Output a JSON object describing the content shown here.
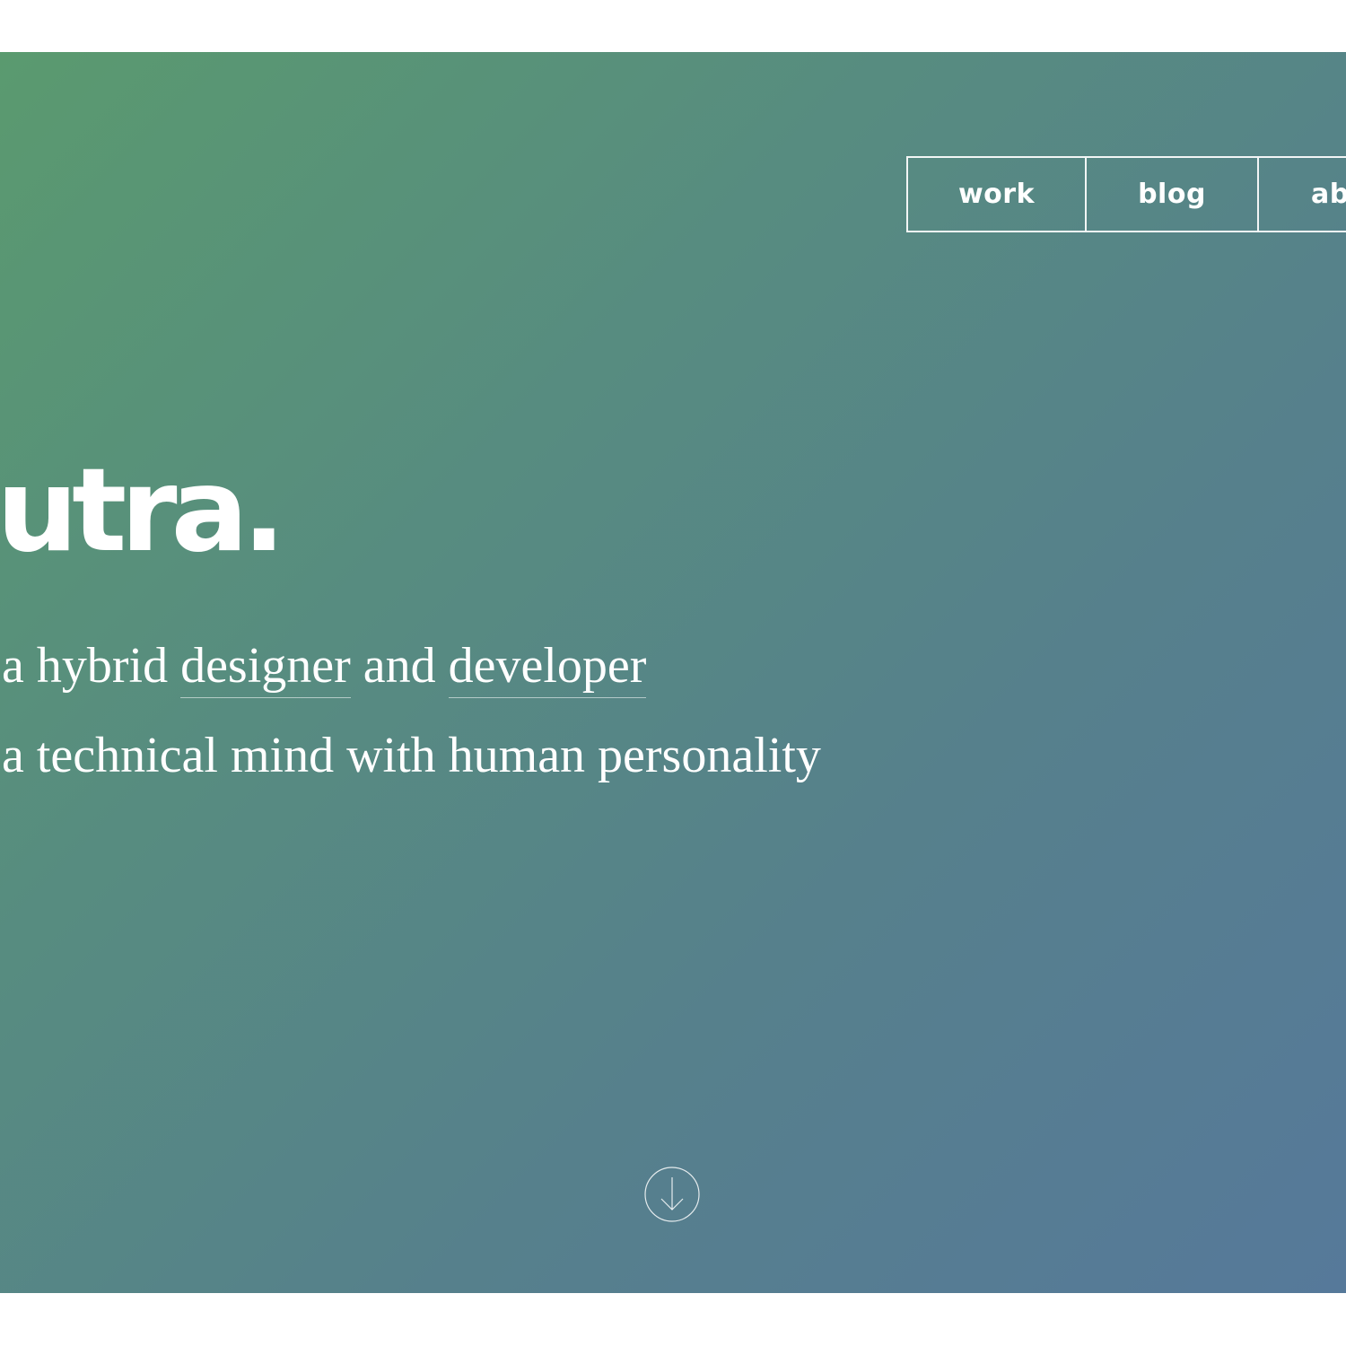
{
  "nav": {
    "items": [
      {
        "label": "work"
      },
      {
        "label": "blog"
      },
      {
        "label": "ab"
      }
    ]
  },
  "hero": {
    "brand": "utra.",
    "line1": {
      "prefix": "a hybrid ",
      "link1": "designer",
      "middle": " and ",
      "link2": "developer"
    },
    "line2": "a technical mind with human personality"
  },
  "icons": {
    "scroll": "arrow-down-circle-icon"
  },
  "colors": {
    "gradient_start": "#5a9a6f",
    "gradient_end": "#56799a",
    "text": "#ffffff"
  }
}
